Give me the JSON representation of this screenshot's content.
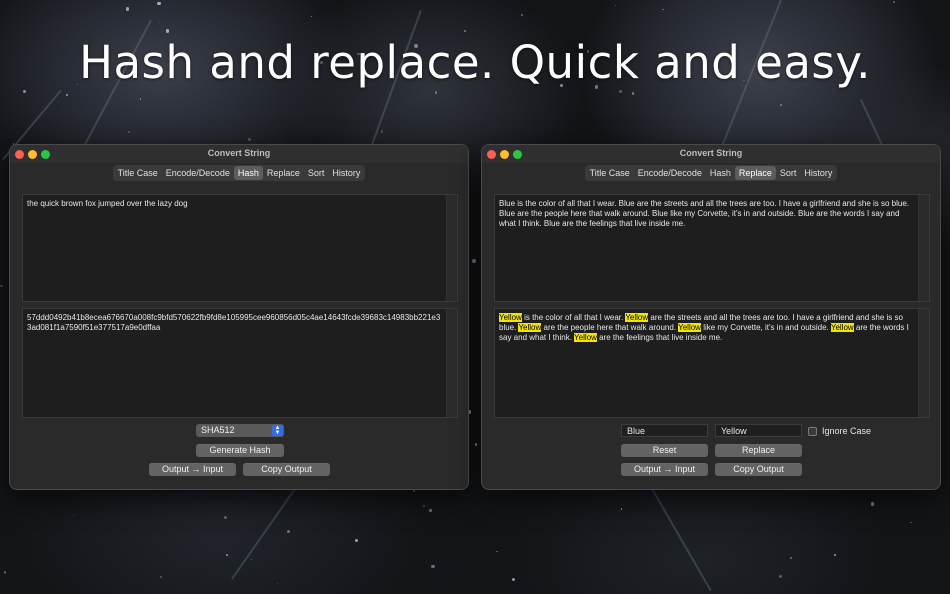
{
  "headline": "Hash and replace. Quick and easy.",
  "left_window": {
    "title": "Convert String",
    "tabs": [
      {
        "label": "Title Case",
        "active": false
      },
      {
        "label": "Encode/Decode",
        "active": false
      },
      {
        "label": "Hash",
        "active": true
      },
      {
        "label": "Replace",
        "active": false
      },
      {
        "label": "Sort",
        "active": false
      },
      {
        "label": "History",
        "active": false
      }
    ],
    "input_text": "the quick brown fox jumped over the lazy dog",
    "output_text": "57ddd0492b41b8ecea676670a008fc9bfd570622fb9fd8e105995cee960856d05c4ae14643fcde39683c14983bb221e33ad081f1a7590f51e377517a9e0dffaa",
    "algorithm_selected": "SHA512",
    "generate_label": "Generate Hash",
    "output_to_input_label": "Output → Input",
    "copy_output_label": "Copy Output"
  },
  "right_window": {
    "title": "Convert String",
    "tabs": [
      {
        "label": "Title Case",
        "active": false
      },
      {
        "label": "Encode/Decode",
        "active": false
      },
      {
        "label": "Hash",
        "active": false
      },
      {
        "label": "Replace",
        "active": true
      },
      {
        "label": "Sort",
        "active": false
      },
      {
        "label": "History",
        "active": false
      }
    ],
    "input_text": "Blue is the color of all that I wear. Blue are the streets and all the trees are too. I have a girlfriend and she is so blue. Blue are the people here that walk around. Blue like my Corvette, it's in and outside. Blue are the words I say and what I think. Blue are the feelings that live inside me.",
    "output_segments": [
      {
        "text": "Yellow",
        "highlight": true
      },
      {
        "text": " is the color of all that I wear. ",
        "highlight": false
      },
      {
        "text": "Yellow",
        "highlight": true
      },
      {
        "text": " are the streets and all the trees are too. I have a girlfriend and she is so blue. ",
        "highlight": false
      },
      {
        "text": "Yellow",
        "highlight": true
      },
      {
        "text": " are the people here that walk around. ",
        "highlight": false
      },
      {
        "text": "Yellow",
        "highlight": true
      },
      {
        "text": " like my Corvette, it's in and outside. ",
        "highlight": false
      },
      {
        "text": "Yellow",
        "highlight": true
      },
      {
        "text": " are the words I say and what I think. ",
        "highlight": false
      },
      {
        "text": "Yellow",
        "highlight": true
      },
      {
        "text": " are the feelings that live inside me.",
        "highlight": false
      }
    ],
    "find_value": "Blue",
    "replace_value": "Yellow",
    "ignore_case_label": "Ignore Case",
    "ignore_case_checked": false,
    "reset_label": "Reset",
    "replace_label": "Replace",
    "output_to_input_label": "Output → Input",
    "copy_output_label": "Copy Output"
  },
  "colors": {
    "highlight": "#f2e600",
    "close": "#ff5f57",
    "minimize": "#febc2e",
    "maximize": "#28c840",
    "popup_accent": "#2f6ee8"
  },
  "icons": {
    "traffic_lights": [
      "close-icon",
      "minimize-icon",
      "maximize-icon"
    ],
    "popup": "chevron-up-down-icon"
  }
}
